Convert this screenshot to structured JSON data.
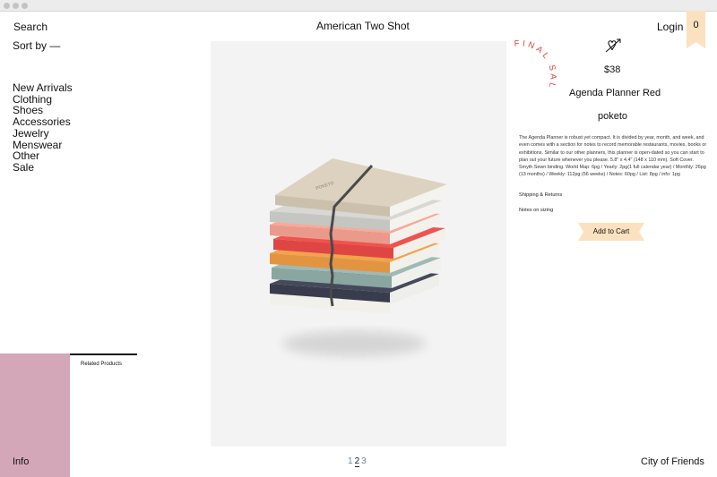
{
  "header": {
    "search": "Search",
    "brand": "American Two Shot",
    "login": "Login",
    "cart_count": "0"
  },
  "sort": {
    "label": "Sort by —"
  },
  "menu": {
    "items": [
      "New Arrivals",
      "Clothing",
      "Shoes",
      "Accessories",
      "Jewelry",
      "Menswear",
      "Other",
      "Sale"
    ]
  },
  "product": {
    "badge": "FINAL SALE",
    "price": "$38",
    "name": "Agenda Planner Red",
    "vendor": "poketo",
    "description": "The Agenda Planner is robust yet compact. It is divided by year, month, and week, and even comes with a section for notes to record memorable restaurants, movies, books or exhibitions. Similar to our other planners, this planner is open-dated so you can start to plan out your future whenever you please. 5.8\" x 4.4\" (148 x 110 mm). Soft Cover. Smyth Sewn binding. World Map: 6pg / Yearly: 2pg(1 full calendar year) / Monthly: 26pg (13 months) / Weekly: 112pg (56 weeks) / Notes: 60pg / List: 8pg / info: 1pg",
    "shipping_link": "Shipping & Returns",
    "sizing_link": "Notes on sizing",
    "add_to_cart": "Add to Cart",
    "cover_text": "POKETO"
  },
  "related": {
    "label": "Related Products"
  },
  "footer": {
    "info": "Info",
    "pages": [
      "1",
      "2",
      "3"
    ],
    "current_page": "2",
    "city": "City of Friends"
  },
  "colors": {
    "accent_peach": "#fbe1bf",
    "info_pink": "#d3a7b8",
    "sale_red": "#e0463f"
  }
}
